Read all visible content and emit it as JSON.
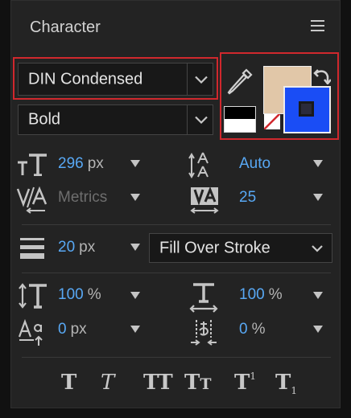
{
  "panel": {
    "title": "Character"
  },
  "font": {
    "family": "DIN Condensed",
    "style": "Bold"
  },
  "colors": {
    "fill": "#e1c7a8",
    "stroke": "#1a4df5",
    "accent_highlight": "#d0282d",
    "value_blue": "#58a8f4"
  },
  "size": {
    "value": "296",
    "unit": "px"
  },
  "leading": {
    "value": "Auto"
  },
  "kerning": {
    "value": "Metrics"
  },
  "tracking": {
    "value": "25"
  },
  "stroke_width": {
    "value": "20",
    "unit": "px"
  },
  "stroke_mode": {
    "value": "Fill Over Stroke"
  },
  "vertical_scale": {
    "value": "100",
    "unit": "%"
  },
  "horizontal_scale": {
    "value": "100",
    "unit": "%"
  },
  "baseline_shift": {
    "value": "0",
    "unit": "px"
  },
  "tsume": {
    "value": "0",
    "unit": "%"
  },
  "format_buttons": {
    "faux_bold": "T",
    "faux_italic": "T",
    "all_caps": "TT",
    "small_caps": "TT",
    "superscript": "T",
    "superscript_mark": "1",
    "subscript": "T",
    "subscript_mark": "1"
  },
  "icons": [
    "menu-icon",
    "chevron-down-icon",
    "eyedropper-icon",
    "swap-colors-icon",
    "font-size-icon",
    "leading-icon",
    "kerning-icon",
    "tracking-icon",
    "stroke-width-icon",
    "vertical-scale-icon",
    "horizontal-scale-icon",
    "baseline-shift-icon",
    "tsume-icon"
  ]
}
